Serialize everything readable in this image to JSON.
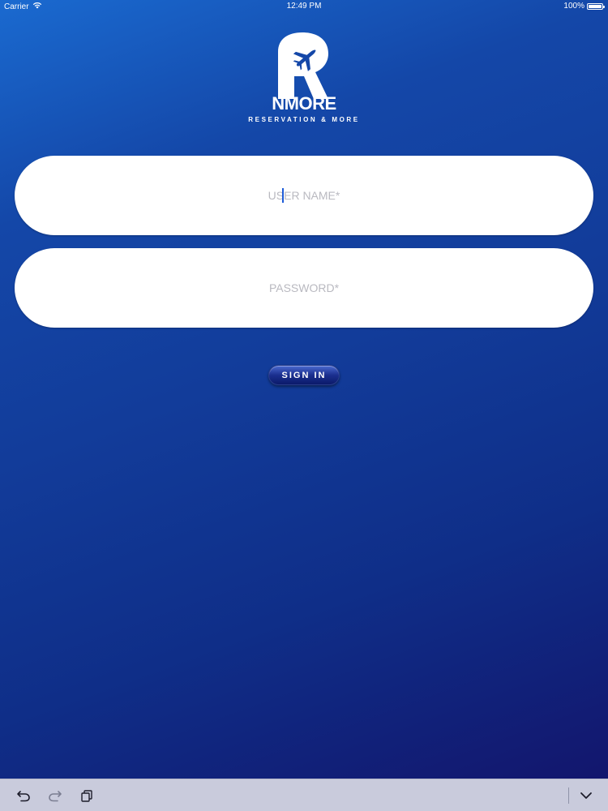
{
  "status_bar": {
    "carrier": "Carrier",
    "time": "12:49 PM",
    "battery": "100%",
    "battery_level": 1.0,
    "wifi_icon": "wifi-icon",
    "battery_icon": "battery-icon"
  },
  "logo": {
    "name": "NMORE",
    "tagline": "RESERVATION & MORE",
    "mark_icon": "r-airplane-logo-icon"
  },
  "form": {
    "username_placeholder": "USER NAME*",
    "password_placeholder": "PASSWORD*",
    "signin_label": "SIGN IN"
  },
  "keyboard_bar": {
    "undo_icon": "undo-icon",
    "redo_icon": "redo-icon",
    "paste_icon": "paste-icon",
    "dismiss_icon": "chevron-down-icon"
  },
  "colors": {
    "background_top": "#1a6ad0",
    "background_bottom": "#13136a",
    "field_background": "#ffffff",
    "placeholder": "#b9b9c0",
    "caret": "#1d5bd8",
    "button": "#1b2f8f",
    "bottom_bar": "#c9cbdc"
  }
}
